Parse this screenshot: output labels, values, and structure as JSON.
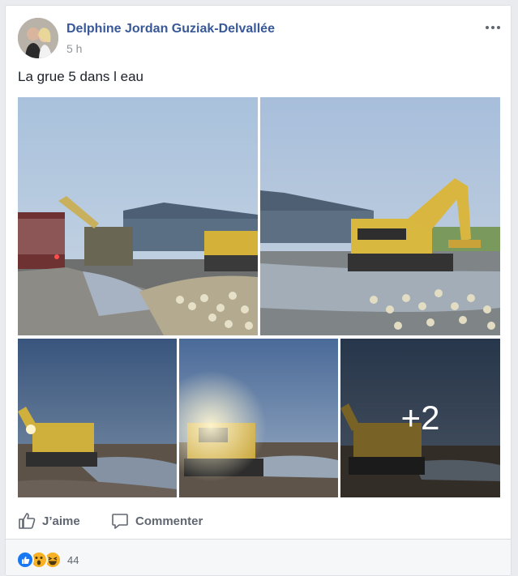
{
  "post": {
    "author_name": "Delphine Jordan Guziak-Delvallée",
    "timestamp": "5 h",
    "text": "La grue 5 dans l eau",
    "more_icon": "ellipsis-icon"
  },
  "photos": {
    "more_count_label": "+2",
    "items": [
      {
        "description": "excavator near hangar with flooded field and sugar beets"
      },
      {
        "description": "komatsu excavator in flooded field near hangar"
      },
      {
        "description": "excavator with headlights at dusk"
      },
      {
        "description": "excavator with headlights at dusk"
      },
      {
        "description": "excavator with headlights at dusk"
      }
    ]
  },
  "actions": {
    "like_label": "J’aime",
    "comment_label": "Commenter"
  },
  "reactions": {
    "types": [
      "like",
      "wow",
      "haha"
    ],
    "count": "44"
  },
  "colors": {
    "link": "#385898",
    "like_blue": "#1877f2",
    "reaction_yellow": "#f7b125"
  }
}
